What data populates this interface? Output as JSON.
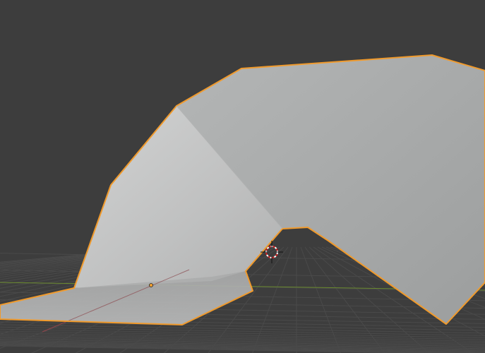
{
  "viewport": {
    "colors": {
      "background": "#3d3d3d",
      "grid": "#4a4a4a",
      "x_axis": "#8a3a3f",
      "y_axis": "#6a8a2e",
      "selection_outline": "#f09a2c",
      "face_light": "#c4c5c5",
      "face_dark": "#a3a5a5",
      "origin": "#f0a030"
    }
  }
}
